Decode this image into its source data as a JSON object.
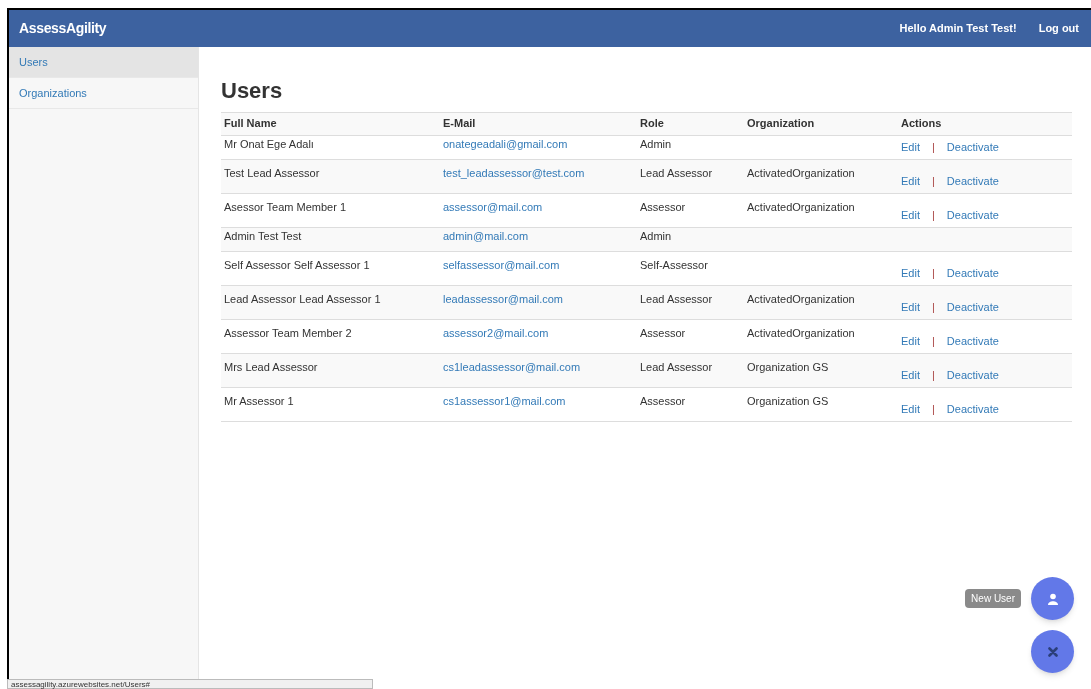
{
  "navbar": {
    "brand": "AssessAgility",
    "greeting": "Hello Admin Test Test!",
    "logout": "Log out"
  },
  "sidebar": {
    "items": [
      {
        "label": "Users",
        "selected": true
      },
      {
        "label": "Organizations",
        "selected": false
      }
    ]
  },
  "page_title": "Users",
  "table": {
    "columns": [
      "Full Name",
      "E-Mail",
      "Role",
      "Organization",
      "Actions"
    ],
    "rows": [
      {
        "full_name": "Mr Onat Ege Adalı",
        "email": "onategeadali@gmail.com",
        "role": "Admin",
        "actions": [
          {
            "kind": "link",
            "label": "Edit"
          },
          {
            "kind": "separator",
            "label": "|"
          },
          {
            "kind": "link",
            "label": "Deactivate"
          }
        ]
      },
      {
        "full_name": "Test Lead Assessor",
        "email": "test_leadassessor@test.com",
        "role": "Lead Assessor",
        "organization": "ActivatedOrganization",
        "actions": [
          {
            "kind": "link",
            "label": "Edit"
          },
          {
            "kind": "separator",
            "label": "|"
          },
          {
            "kind": "link",
            "label": "Deactivate"
          }
        ]
      },
      {
        "full_name": "Asessor Team Member 1",
        "email": "assessor@mail.com",
        "role": "Assessor",
        "organization": "ActivatedOrganization",
        "actions": [
          {
            "kind": "link",
            "label": "Edit"
          },
          {
            "kind": "separator",
            "label": "|"
          },
          {
            "kind": "link",
            "label": "Deactivate"
          }
        ]
      },
      {
        "full_name": "Admin Test Test",
        "email": "admin@mail.com",
        "role": "Admin"
      },
      {
        "full_name": "Self Assessor Self Assessor 1",
        "email": "selfassessor@mail.com",
        "role": "Self-Assessor",
        "actions": [
          {
            "kind": "link",
            "label": "Edit"
          },
          {
            "kind": "separator",
            "label": "|"
          },
          {
            "kind": "link",
            "label": "Deactivate"
          }
        ]
      },
      {
        "full_name": "Lead Assessor Lead Assessor 1",
        "email": "leadassessor@mail.com",
        "role": "Lead Assessor",
        "organization": "ActivatedOrganization",
        "actions": [
          {
            "kind": "link",
            "label": "Edit"
          },
          {
            "kind": "separator",
            "label": "|"
          },
          {
            "kind": "link",
            "label": "Deactivate"
          }
        ]
      },
      {
        "full_name": "Assessor Team Member 2",
        "email": "assessor2@mail.com",
        "role": "Assessor",
        "organization": "ActivatedOrganization",
        "actions": [
          {
            "kind": "link",
            "label": "Edit"
          },
          {
            "kind": "separator",
            "label": "|"
          },
          {
            "kind": "link",
            "label": "Deactivate"
          }
        ]
      },
      {
        "full_name": "Mrs Lead Assessor",
        "email": "cs1leadassessor@mail.com",
        "role": "Lead Assessor",
        "organization": "Organization GS",
        "actions": [
          {
            "kind": "link",
            "label": "Edit"
          },
          {
            "kind": "separator",
            "label": "|"
          },
          {
            "kind": "link",
            "label": "Deactivate"
          }
        ]
      },
      {
        "full_name": "Mr Assessor 1",
        "email": "cs1assessor1@mail.com",
        "role": "Assessor",
        "organization": "Organization GS",
        "actions": [
          {
            "kind": "link",
            "label": "Edit"
          },
          {
            "kind": "separator",
            "label": "|"
          },
          {
            "kind": "link",
            "label": "Deactivate"
          }
        ]
      }
    ]
  },
  "fab": {
    "tooltip": "New User"
  },
  "status_bar": {
    "url": "assessagility.azurewebsites.net/Users#"
  }
}
